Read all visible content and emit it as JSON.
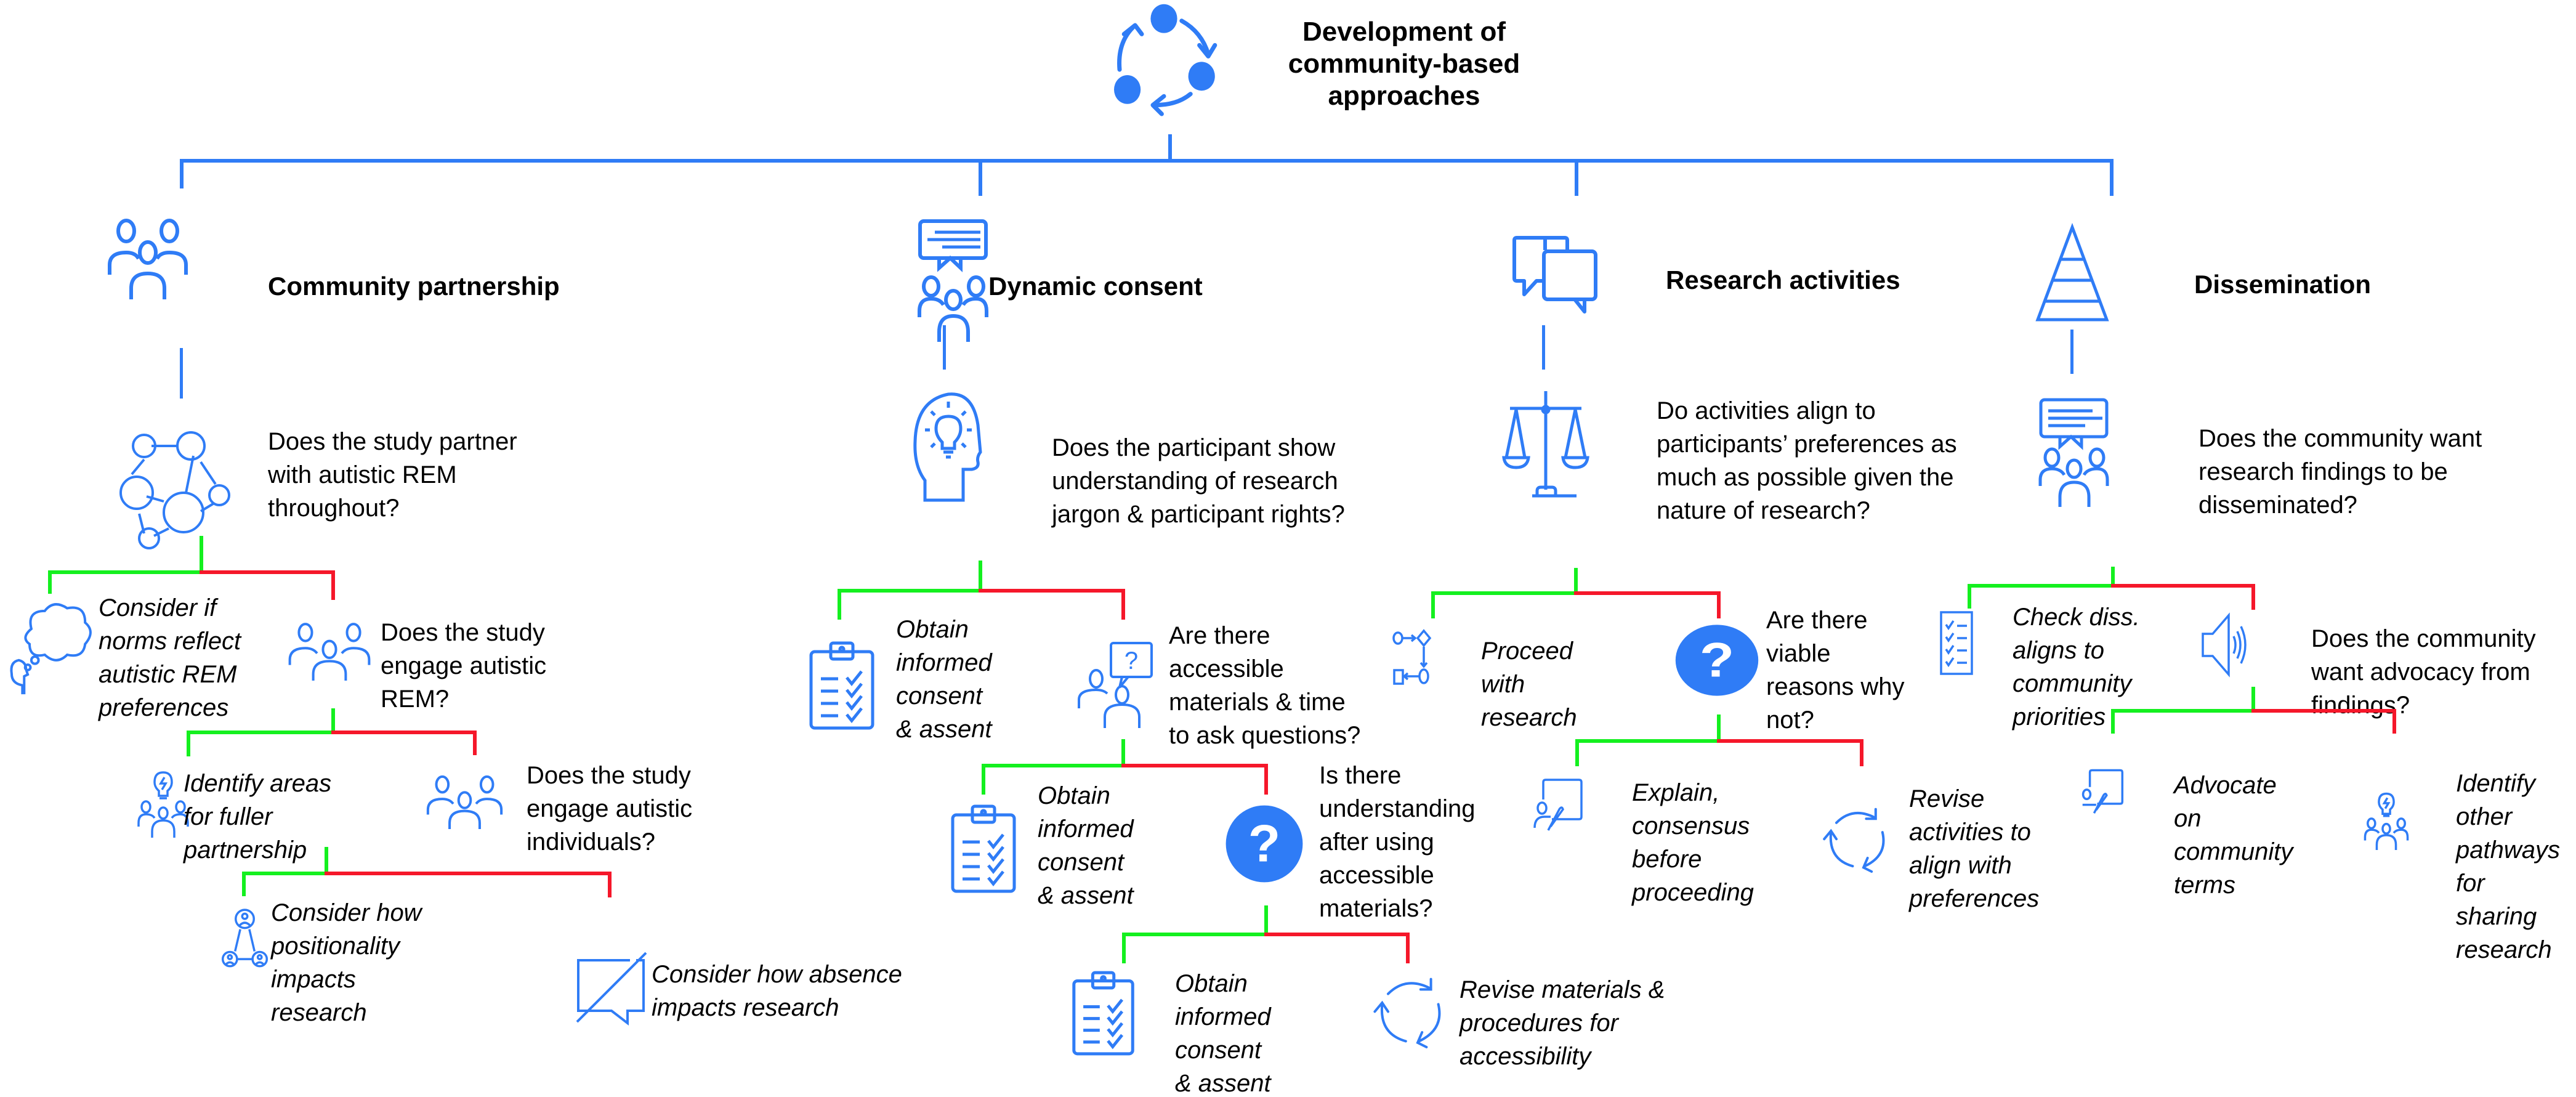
{
  "title": {
    "line1": "Development of",
    "line2": "community-based",
    "line3": "approaches",
    "icon": "cycle-icon"
  },
  "colors": {
    "structure": "#2f7cf6",
    "yes_branch": "#14f01f",
    "no_branch": "#f5172a",
    "icon": "#2f7cf6",
    "text": "#000000"
  },
  "legend_semantics": {
    "green_branch": "yes",
    "red_branch": "no"
  },
  "columns": [
    {
      "category": "Community partnership",
      "category_icon": "group-icon",
      "question": {
        "icon": "network-icon",
        "lines": [
          "Does the study partner",
          "with autistic REM",
          "throughout?"
        ]
      },
      "yes": {
        "icon": "thought-bubble-icon",
        "lines": [
          "Consider if",
          "norms reflect",
          "autistic REM",
          "preferences"
        ]
      },
      "no": {
        "icon": "group-icon",
        "lines": [
          "Does the study",
          "engage autistic",
          "REM?"
        ],
        "yes": {
          "icon": "group-lightbulb-icon",
          "lines": [
            "Identify areas",
            "for fuller",
            "partnership"
          ]
        },
        "no": {
          "icon": "group-icon",
          "lines": [
            "Does the study",
            "engage autistic",
            "individuals?"
          ],
          "yes": {
            "icon": "connected-people-icon",
            "lines": [
              "Consider how",
              "positionality",
              "impacts",
              "research"
            ]
          },
          "no": {
            "icon": "no-chat-icon",
            "lines": [
              "Consider how absence",
              "impacts research"
            ]
          }
        }
      }
    },
    {
      "category": "Dynamic consent",
      "category_icon": "group-speech-icon",
      "question": {
        "icon": "head-lightbulb-icon",
        "lines": [
          "Does the participant show",
          "understanding of research",
          "jargon & participant rights?"
        ]
      },
      "yes": {
        "icon": "clipboard-checklist-icon",
        "lines": [
          "Obtain",
          "informed",
          "consent",
          "& assent"
        ]
      },
      "no": {
        "icon": "person-question-icon",
        "lines": [
          "Are there",
          "accessible",
          "materials & time",
          "to ask questions?"
        ],
        "yes": {
          "icon": "clipboard-checklist-icon",
          "lines": [
            "Obtain",
            "informed",
            "consent",
            "& assent"
          ]
        },
        "no": {
          "icon": "question-circle-icon",
          "lines": [
            "Is there",
            "understanding",
            "after using",
            "accessible",
            "materials?"
          ],
          "yes": {
            "icon": "clipboard-checklist-icon",
            "lines": [
              "Obtain",
              "informed",
              "consent",
              "& assent"
            ]
          },
          "no": {
            "icon": "refresh-cycle-icon",
            "lines": [
              "Revise materials &",
              "procedures for",
              "accessibility"
            ]
          }
        }
      }
    },
    {
      "category": "Research activities",
      "category_icon": "chat-bubbles-icon",
      "question": {
        "icon": "balance-scale-icon",
        "lines": [
          "Do activities align to",
          "participants’ preferences as",
          "much as possible given the",
          "nature of research?"
        ]
      },
      "yes": {
        "icon": "process-flow-icon",
        "lines": [
          "Proceed",
          "with",
          "research"
        ]
      },
      "no": {
        "icon": "question-circle-icon",
        "lines": [
          "Are there",
          "viable",
          "reasons why",
          "not?"
        ],
        "yes": {
          "icon": "presenter-board-icon",
          "lines": [
            "Explain,",
            "consensus",
            "before",
            "proceeding"
          ]
        },
        "no": {
          "icon": "refresh-cycle-icon",
          "lines": [
            "Revise",
            "activities to",
            "align with",
            "preferences"
          ]
        }
      }
    },
    {
      "category": "Dissemination",
      "category_icon": "pyramid-icon",
      "question": {
        "icon": "group-speech-icon",
        "lines": [
          "Does the community want",
          "research findings to be",
          "disseminated?"
        ]
      },
      "yes": {
        "icon": "checklist-icon",
        "lines": [
          "Check diss.",
          "aligns to",
          "community",
          "priorities"
        ]
      },
      "no": {
        "icon": "speaker-icon",
        "lines": [
          "Does the community",
          "want advocacy from",
          "findings?"
        ],
        "yes": {
          "icon": "presenter-board-icon",
          "lines": [
            "Advocate",
            "on",
            "community",
            "terms"
          ]
        },
        "no": {
          "icon": "group-lightbulb-icon",
          "lines": [
            "Identify",
            "other",
            "pathways",
            "for",
            "sharing",
            "research"
          ]
        }
      }
    }
  ]
}
